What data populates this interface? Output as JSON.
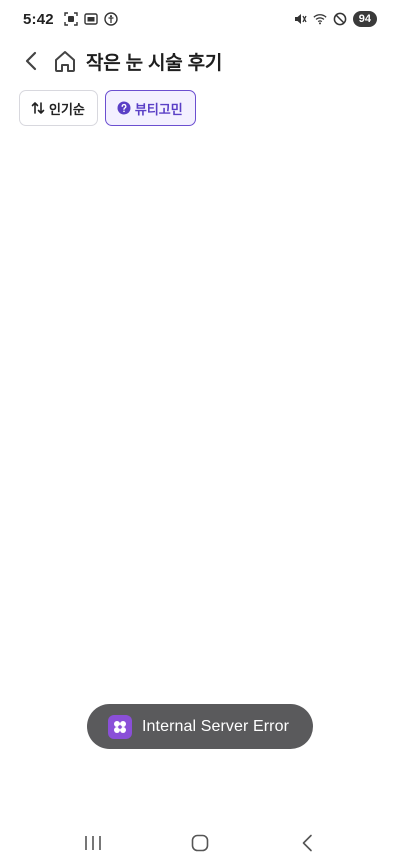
{
  "status_bar": {
    "time": "5:42",
    "battery": "94",
    "left_icons": [
      "screenshot-icon",
      "cast-icon",
      "accessibility-icon"
    ],
    "right_icons": [
      "mute-icon",
      "wifi-icon",
      "dnd-icon"
    ]
  },
  "header": {
    "title": "작은 눈 시술 후기"
  },
  "chips": [
    {
      "label": "인기순",
      "icon": "sort-icon",
      "active": false
    },
    {
      "label": "뷰티고민",
      "icon": "question-icon",
      "active": true
    }
  ],
  "toast": {
    "message": "Internal Server Error",
    "icon": "app-logo-icon"
  },
  "colors": {
    "accent": "#6b4fd0",
    "toast_bg": "#5a5a5c",
    "toast_icon_bg": "#8a4fd8"
  }
}
